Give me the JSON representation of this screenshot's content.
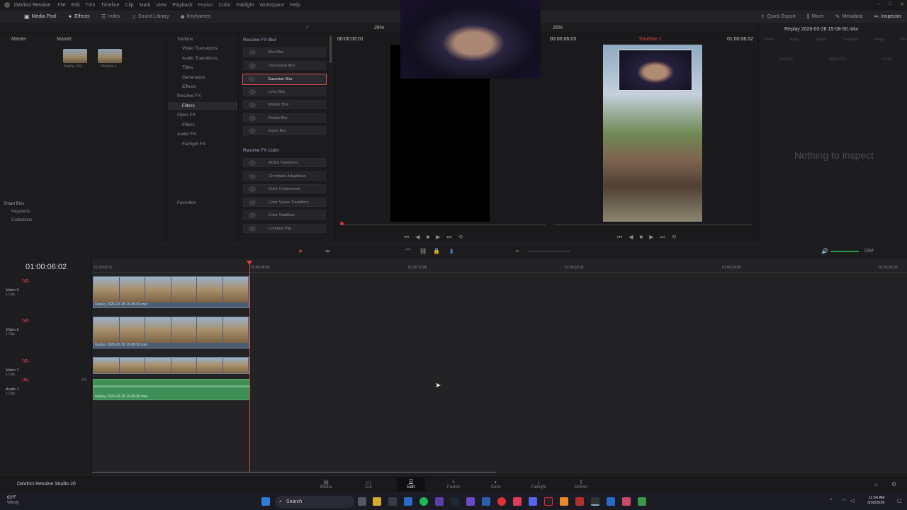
{
  "menubar": {
    "app": "DaVinci Resolve",
    "items": [
      "File",
      "Edit",
      "Trim",
      "Timeline",
      "Clip",
      "Mark",
      "View",
      "Playback",
      "Fusion",
      "Color",
      "Fairlight",
      "Workspace",
      "Help"
    ]
  },
  "toolbar": {
    "left": [
      "Media Pool",
      "Effects",
      "Index",
      "Sound Library",
      "Keyframes"
    ],
    "right": [
      "Quick Export",
      "Mixer",
      "Metadata",
      "Inspector"
    ]
  },
  "viewer": {
    "source_zoom": "26%",
    "source_tc": "00:00:00:01",
    "prog_zoom": "26%",
    "prog_tc_left": "00:00:06:03",
    "timeline_name": "Timeline 1",
    "prog_tc_right": "01:00:06:02"
  },
  "inspector": {
    "title": "Replay 2026-03-28 15-08-50.mkv",
    "tabs": [
      "Video",
      "Audio",
      "Effects",
      "Transition",
      "Image",
      "File"
    ],
    "subtabs": [
      "Position",
      "Open FX",
      "Audio"
    ],
    "empty": "Nothing to inspect"
  },
  "mediapool": {
    "col1": "Master",
    "col2": "Master",
    "clips": [
      "Replay 202...",
      "Timeline 1"
    ],
    "smart_bins": "Smart Bins",
    "keywords": "Keywords",
    "collections": "Collections"
  },
  "fxtree": {
    "items": [
      "Toolbox",
      "Video Transitions",
      "Audio Transitions",
      "Titles",
      "Generators",
      "Effects",
      "Resolve FX",
      "Filters",
      "Open FX",
      "Filters",
      "Audio FX",
      "Fairlight FX"
    ],
    "favorites": "Favorites"
  },
  "fxlist": {
    "header1": "Resolve FX Blur",
    "blur": [
      "Box Blur",
      "Directional Blur",
      "Gaussian Blur",
      "Lens Blur",
      "Mosaic Blur",
      "Radial Blur",
      "Zoom Blur"
    ],
    "header2": "Resolve FX Color",
    "color": [
      "ACES Transform",
      "Chromatic Adaptation",
      "Color Compressor",
      "Color Space Transform",
      "Color Stabilizer",
      "Contrast Pop"
    ]
  },
  "timeline": {
    "timecode": "01:00:06:02",
    "ruler": [
      "01:00:00:00",
      "01:00:06:00",
      "01:00:12:00",
      "01:00:18:00",
      "01:00:24:00",
      "01:00:30:00"
    ],
    "audio_level": "DIM",
    "tracks": [
      {
        "id": "V3",
        "name": "Video 3",
        "clips": "1 Clip"
      },
      {
        "id": "V2",
        "name": "Video 2",
        "clips": "1 Clip"
      },
      {
        "id": "V1",
        "name": "Video 1",
        "clips": "1 Clip"
      },
      {
        "id": "A1",
        "name": "Audio 1",
        "clips": "1 Clip",
        "ch": "2.0"
      }
    ],
    "clip_name": "Replay 2026-03-28 15-08-50.mkv"
  },
  "pages": {
    "brand": "DaVinci Resolve Studio 20",
    "items": [
      "Media",
      "Cut",
      "Edit",
      "Fusion",
      "Color",
      "Fairlight",
      "Deliver"
    ],
    "active": "Edit"
  },
  "taskbar": {
    "weather_temp": "63°F",
    "weather_desc": "Windy",
    "search": "Search",
    "time": "11:54 AM",
    "date": "3/30/2026"
  }
}
